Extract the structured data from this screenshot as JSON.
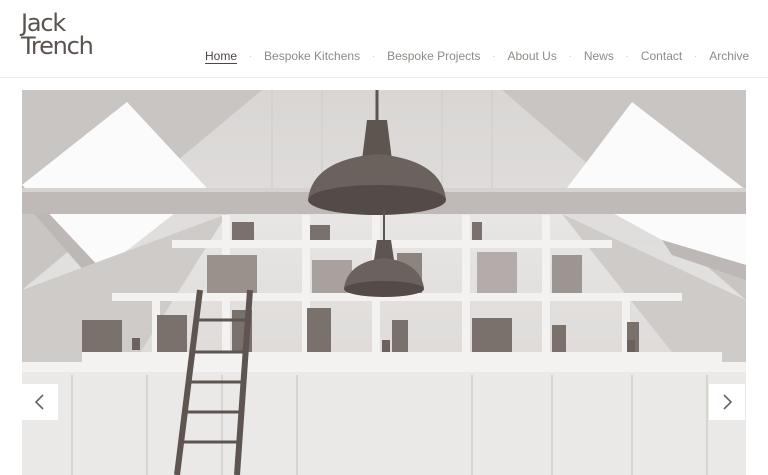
{
  "brand": {
    "line1": "Jack",
    "line2": "Trench"
  },
  "nav": {
    "items": [
      {
        "label": "Home",
        "active": true
      },
      {
        "label": "Bespoke Kitchens",
        "active": false
      },
      {
        "label": "Bespoke Projects",
        "active": false
      },
      {
        "label": "About Us",
        "active": false
      },
      {
        "label": "News",
        "active": false
      },
      {
        "label": "Contact",
        "active": false
      },
      {
        "label": "Archive",
        "active": false
      }
    ],
    "separator": "·"
  },
  "slider": {
    "prev_icon": "chevron-left-icon",
    "next_icon": "chevron-right-icon"
  },
  "colors": {
    "text_dark": "#4e4744",
    "text_muted": "#8f8a86",
    "photo_tint": "#6b615d",
    "background": "#ffffff"
  }
}
